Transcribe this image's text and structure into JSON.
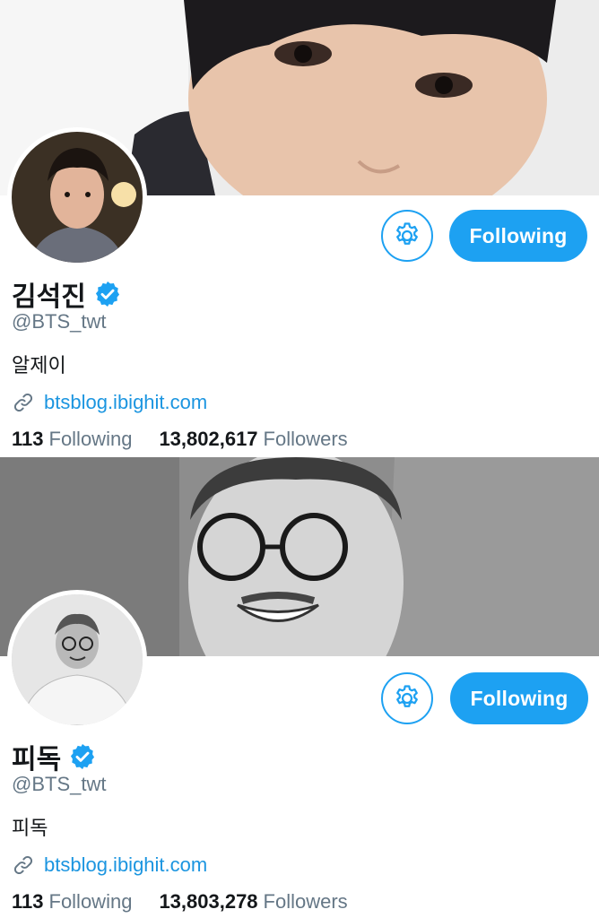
{
  "profiles": [
    {
      "name": "김석진",
      "handle": "@BTS_twt",
      "bio": "알제이",
      "link": "btsblog.ibighit.com",
      "follow_button": "Following",
      "following_count": "113",
      "following_label": "Following",
      "followers_count": "13,802,617",
      "followers_label": "Followers"
    },
    {
      "name": "피독",
      "handle": "@BTS_twt",
      "bio": "피독",
      "link": "btsblog.ibighit.com",
      "follow_button": "Following",
      "following_count": "113",
      "following_label": "Following",
      "followers_count": "13,803,278",
      "followers_label": "Followers"
    }
  ],
  "colors": {
    "accent": "#1da1f2",
    "link": "#1b95e0",
    "muted": "#657786",
    "text": "#14171a"
  },
  "icons": {
    "settings": "gear-icon",
    "verified": "verified-badge-icon",
    "link": "link-icon"
  }
}
